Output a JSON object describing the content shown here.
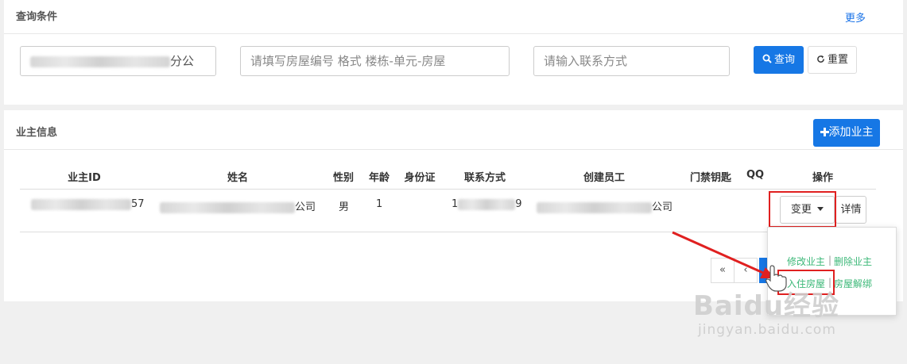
{
  "query_panel": {
    "title": "查询条件",
    "more_link": "更多",
    "company_input": {
      "visible_suffix": "分公"
    },
    "room_input": {
      "placeholder": "请填写房屋编号 格式 楼栋-单元-房屋"
    },
    "contact_input": {
      "placeholder": "请输入联系方式"
    },
    "search_button": "查询",
    "reset_button": "重置"
  },
  "owner_panel": {
    "title": "业主信息",
    "add_button": "添加业主",
    "table": {
      "columns": [
        "业主ID",
        "姓名",
        "性别",
        "年龄",
        "身份证",
        "联系方式",
        "创建员工",
        "门禁钥匙",
        "QQ",
        "操作"
      ],
      "rows": [
        {
          "owner_id_suffix": "57",
          "name_suffix": "公司",
          "gender": "男",
          "age": "1",
          "id_card": "",
          "contact_prefix": "1",
          "contact_suffix": "9",
          "creator_suffix": "公司",
          "access_key": "",
          "qq": "",
          "change_button": "变更",
          "detail_button": "详情"
        }
      ]
    },
    "pagination": {
      "first": "«",
      "prev": "‹"
    }
  },
  "dropdown_menu": {
    "edit_owner": "修改业主",
    "delete_owner": "删除业主",
    "move_in": "入住房屋",
    "unbind_room": "房屋解绑",
    "separator": "|"
  },
  "watermark": {
    "brand": "Baidu经验",
    "url": "jingyan.baidu.com"
  },
  "colors": {
    "primary": "#1677e5",
    "link_green": "#3cb878",
    "annotation_red": "#e02020",
    "page_bg": "#f0f0f0"
  }
}
